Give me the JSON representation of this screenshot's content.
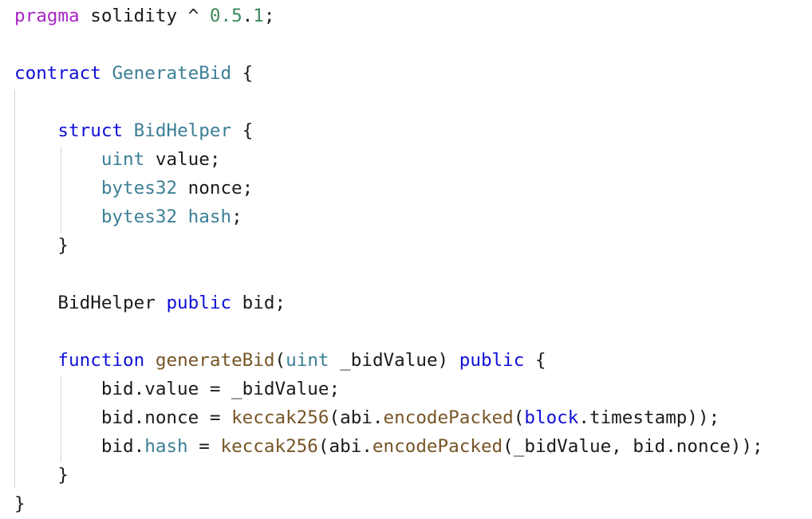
{
  "code": {
    "lines": [
      [
        {
          "t": "pragma",
          "c": "pragma"
        },
        {
          "t": " solidity ^ ",
          "c": "id"
        },
        {
          "t": "0.5",
          "c": "num"
        },
        {
          "t": ".",
          "c": "id"
        },
        {
          "t": "1",
          "c": "num"
        },
        {
          "t": ";",
          "c": "id"
        }
      ],
      [],
      [
        {
          "t": "contract",
          "c": "kw"
        },
        {
          "t": " ",
          "c": "id"
        },
        {
          "t": "GenerateBid",
          "c": "cls"
        },
        {
          "t": " {",
          "c": "id"
        }
      ],
      [],
      [
        {
          "t": "    ",
          "c": "id"
        },
        {
          "t": "struct",
          "c": "kw"
        },
        {
          "t": " ",
          "c": "id"
        },
        {
          "t": "BidHelper",
          "c": "cls"
        },
        {
          "t": " {",
          "c": "id"
        }
      ],
      [
        {
          "t": "        ",
          "c": "id"
        },
        {
          "t": "uint",
          "c": "type"
        },
        {
          "t": " value;",
          "c": "id"
        }
      ],
      [
        {
          "t": "        ",
          "c": "id"
        },
        {
          "t": "bytes32",
          "c": "type"
        },
        {
          "t": " nonce;",
          "c": "id"
        }
      ],
      [
        {
          "t": "        ",
          "c": "id"
        },
        {
          "t": "bytes32",
          "c": "type"
        },
        {
          "t": " ",
          "c": "id"
        },
        {
          "t": "hash",
          "c": "type"
        },
        {
          "t": ";",
          "c": "id"
        }
      ],
      [
        {
          "t": "    }",
          "c": "id"
        }
      ],
      [],
      [
        {
          "t": "    BidHelper ",
          "c": "id"
        },
        {
          "t": "public",
          "c": "kw"
        },
        {
          "t": " bid;",
          "c": "id"
        }
      ],
      [],
      [
        {
          "t": "    ",
          "c": "id"
        },
        {
          "t": "function",
          "c": "kw"
        },
        {
          "t": " ",
          "c": "id"
        },
        {
          "t": "generateBid",
          "c": "fn"
        },
        {
          "t": "(",
          "c": "id"
        },
        {
          "t": "uint",
          "c": "type"
        },
        {
          "t": " _bidValue) ",
          "c": "id"
        },
        {
          "t": "public",
          "c": "kw"
        },
        {
          "t": " {",
          "c": "id"
        }
      ],
      [
        {
          "t": "        bid.value = _bidValue;",
          "c": "id"
        }
      ],
      [
        {
          "t": "        bid.nonce = ",
          "c": "id"
        },
        {
          "t": "keccak256",
          "c": "fn"
        },
        {
          "t": "(abi.",
          "c": "id"
        },
        {
          "t": "encodePacked",
          "c": "fn"
        },
        {
          "t": "(",
          "c": "id"
        },
        {
          "t": "block",
          "c": "kw"
        },
        {
          "t": ".timestamp));",
          "c": "id"
        }
      ],
      [
        {
          "t": "        bid.",
          "c": "id"
        },
        {
          "t": "hash",
          "c": "type"
        },
        {
          "t": " = ",
          "c": "id"
        },
        {
          "t": "keccak256",
          "c": "fn"
        },
        {
          "t": "(abi.",
          "c": "id"
        },
        {
          "t": "encodePacked",
          "c": "fn"
        },
        {
          "t": "(_bidValue, bid.nonce));",
          "c": "id"
        }
      ],
      [
        {
          "t": "    }",
          "c": "id"
        }
      ],
      [
        {
          "t": "}",
          "c": "id"
        }
      ]
    ]
  }
}
